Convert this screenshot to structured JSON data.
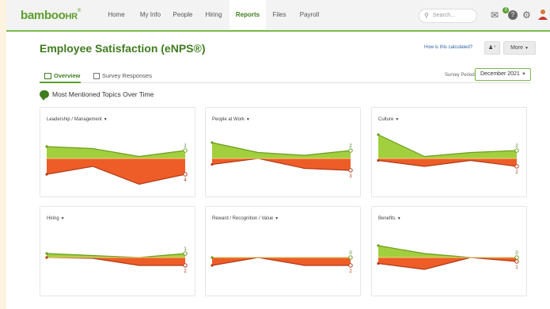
{
  "brand": {
    "name": "bamboo",
    "suffix": "HR",
    "reg": "®"
  },
  "nav": [
    "Home",
    "My Info",
    "People",
    "Hiring",
    "Reports",
    "Files",
    "Payroll"
  ],
  "nav_active": "Reports",
  "search": {
    "placeholder": "Search..."
  },
  "header_icons": [
    "inbox-icon",
    "help-icon",
    "settings-icon",
    "user-avatar-icon"
  ],
  "inbox_count": "3",
  "page": {
    "title": "Employee Satisfaction (eNPS®)",
    "calc_link": "How is this calculated?",
    "more_label": "More",
    "tabs": [
      "Overview",
      "Survey Responses"
    ],
    "survey_period_label": "Survey Period",
    "survey_period_value": "December 2021",
    "section_title": "Most Mentioned Topics Over Time"
  },
  "colors": {
    "positive": "#7ab94a",
    "negative": "#e8531f",
    "brand": "#3f7c1f"
  },
  "chart_data": [
    {
      "type": "area",
      "title": "Leadership / Management",
      "positive": [
        3,
        2.5,
        0.5,
        2
      ],
      "negative": [
        -4,
        -2,
        -6.5,
        -4
      ],
      "positive_label": "2",
      "negative_label": "4"
    },
    {
      "type": "area",
      "title": "People at Work",
      "positive": [
        4,
        1.5,
        0.8,
        2
      ],
      "negative": [
        -1.5,
        0,
        -2.5,
        -3
      ],
      "positive_label": "2",
      "negative_label": "3"
    },
    {
      "type": "area",
      "title": "Culture",
      "positive": [
        6,
        0.5,
        1.5,
        2
      ],
      "negative": [
        -0.5,
        -2,
        -0.5,
        -2
      ],
      "positive_label": "2",
      "negative_label": "2"
    },
    {
      "type": "area",
      "title": "Hiring",
      "positive": [
        1,
        0.5,
        0,
        1
      ],
      "negative": [
        0,
        -0.2,
        -2,
        -2
      ],
      "positive_label": "1",
      "negative_label": "2"
    },
    {
      "type": "area",
      "title": "Reward / Recognition / Value",
      "positive": [
        0,
        0,
        0,
        0
      ],
      "negative": [
        -2,
        0,
        -2,
        -2
      ],
      "positive_label": "0",
      "negative_label": "2"
    },
    {
      "type": "area",
      "title": "Benefits",
      "positive": [
        3,
        1,
        0,
        0
      ],
      "negative": [
        -1.5,
        -3,
        0,
        -1
      ],
      "positive_label": "0",
      "negative_label": "1"
    }
  ]
}
